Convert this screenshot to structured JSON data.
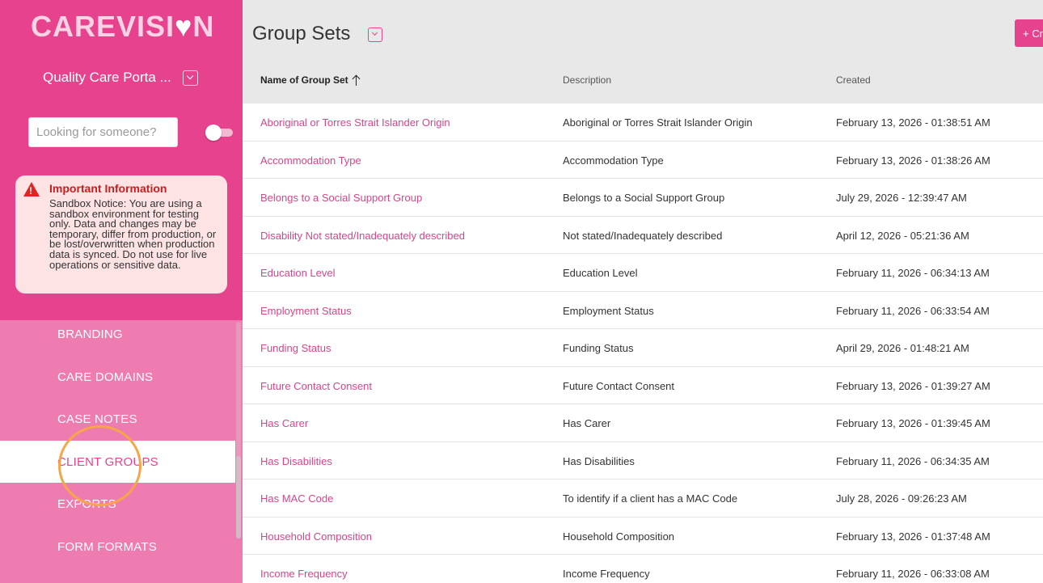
{
  "sidebar": {
    "logo_main": "CAREVISI",
    "logo_heart": "♥",
    "logo_end": "N",
    "portal_name": "Quality Care Porta ...",
    "search_placeholder": "Looking for someone?",
    "info": {
      "title": "Important Information",
      "text": "Sandbox Notice: You are using a sandbox environment for testing only. Data and changes may be temporary, differ from production, or be lost/overwritten when production data is synced. Do not use for live operations or sensitive data."
    },
    "nav": [
      {
        "label": "BRANDING"
      },
      {
        "label": "CARE DOMAINS"
      },
      {
        "label": "CASE NOTES"
      },
      {
        "label": "CLIENT GROUPS"
      },
      {
        "label": "EXPORTS"
      },
      {
        "label": "FORM FORMATS"
      }
    ]
  },
  "header": {
    "title": "Group Sets",
    "create_label": "+ Create"
  },
  "table": {
    "columns": {
      "name": "Name of Group Set",
      "description": "Description",
      "created": "Created"
    },
    "rows": [
      {
        "name": "Aboriginal or Torres Strait Islander Origin",
        "description": "Aboriginal or Torres Strait Islander Origin",
        "created": "February 13, 2026 - 01:38:51 AM"
      },
      {
        "name": "Accommodation Type",
        "description": "Accommodation Type",
        "created": "February 13, 2026 - 01:38:26 AM"
      },
      {
        "name": "Belongs to a Social Support Group",
        "description": "Belongs to a Social Support Group",
        "created": "July 29, 2026 - 12:39:47 AM"
      },
      {
        "name": "Disability Not stated/Inadequately described",
        "description": "Not stated/Inadequately described",
        "created": "April 12, 2026 - 05:21:36 AM"
      },
      {
        "name": "Education Level",
        "description": "Education Level",
        "created": "February 11, 2026 - 06:34:13 AM"
      },
      {
        "name": "Employment Status",
        "description": "Employment Status",
        "created": "February 11, 2026 - 06:33:54 AM"
      },
      {
        "name": "Funding Status",
        "description": "Funding Status",
        "created": "April 29, 2026 - 01:48:21 AM"
      },
      {
        "name": "Future Contact Consent",
        "description": "Future Contact Consent",
        "created": "February 13, 2026 - 01:39:27 AM"
      },
      {
        "name": "Has Carer",
        "description": "Has Carer",
        "created": "February 13, 2026 - 01:39:45 AM"
      },
      {
        "name": "Has Disabilities",
        "description": "Has Disabilities",
        "created": "February 11, 2026 - 06:34:35 AM"
      },
      {
        "name": "Has MAC Code",
        "description": "To identify if a client has a MAC Code",
        "created": "July 28, 2026 - 09:26:23 AM"
      },
      {
        "name": "Household Composition",
        "description": "Household Composition",
        "created": "February 13, 2026 - 01:37:48 AM"
      },
      {
        "name": "Income Frequency",
        "description": "Income Frequency",
        "created": "February 11, 2026 - 06:33:08 AM"
      }
    ]
  },
  "colors": {
    "brand_pink": "#e6428d",
    "nav_pink": "#ee7cb0",
    "link_pink": "#d6458b",
    "header_gray": "#e8e8e8"
  }
}
